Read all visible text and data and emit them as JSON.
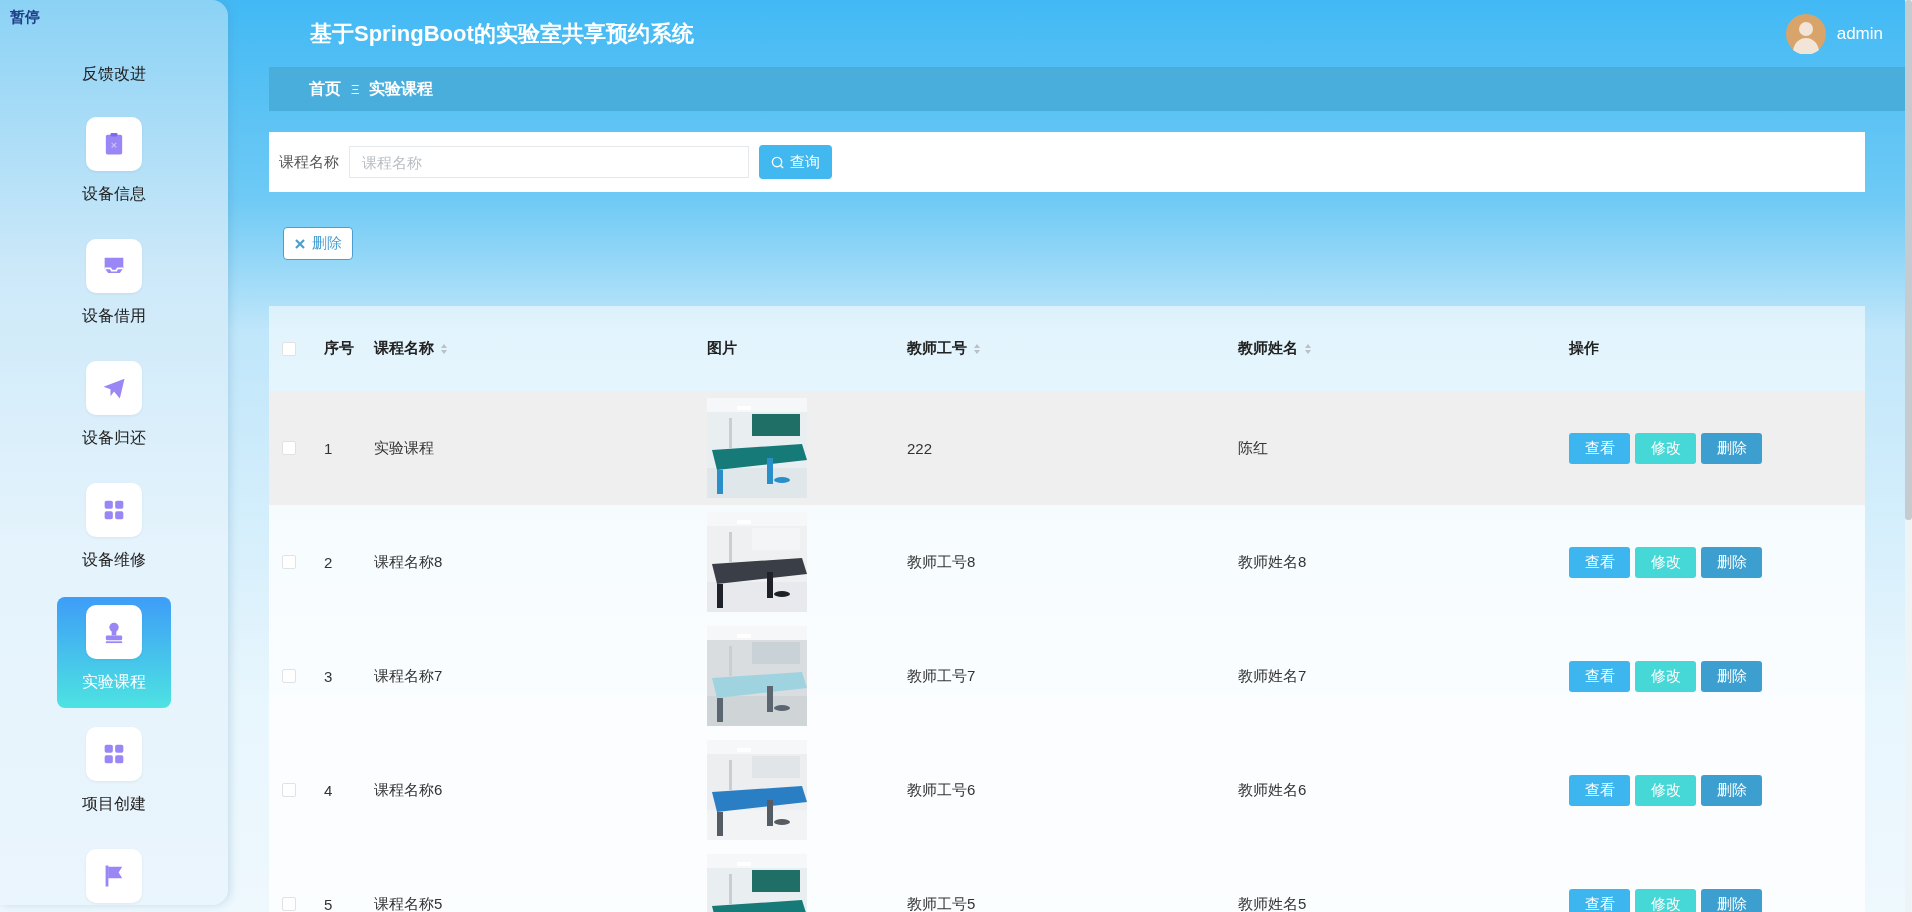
{
  "sidebar": {
    "pause_label": "暂停",
    "items": [
      {
        "label": "反馈改进",
        "selected": false
      },
      {
        "label": "设备信息",
        "selected": false
      },
      {
        "label": "设备借用",
        "selected": false
      },
      {
        "label": "设备归还",
        "selected": false
      },
      {
        "label": "设备维修",
        "selected": false
      },
      {
        "label": "实验课程",
        "selected": true
      },
      {
        "label": "项目创建",
        "selected": false
      },
      {
        "selected": false
      }
    ]
  },
  "header": {
    "title": "基于SpringBoot的实验室共享预约系统",
    "user": "admin"
  },
  "breadcrumb": {
    "items": [
      "首页",
      "实验课程"
    ],
    "separator": "Ξ"
  },
  "search": {
    "label": "课程名称",
    "placeholder": "课程名称",
    "button": "查询"
  },
  "toolbar": {
    "delete_button": "删除"
  },
  "table": {
    "select_all": {
      "checked": false
    },
    "columns": [
      {
        "label": "序号",
        "sortable": false
      },
      {
        "label": "课程名称",
        "sortable": true
      },
      {
        "label": "图片",
        "sortable": false
      },
      {
        "label": "教师工号",
        "sortable": true
      },
      {
        "label": "教师姓名",
        "sortable": true
      },
      {
        "label": "操作",
        "sortable": false
      }
    ],
    "rows": [
      {
        "checked": false,
        "highlighted": true,
        "index": "1",
        "name": "实验课程",
        "teacher_id": "222",
        "teacher_name": "陈红",
        "actions": [
          {
            "kind": "view",
            "label": "查看"
          },
          {
            "kind": "edit",
            "label": "修改"
          },
          {
            "kind": "delete",
            "label": "删除"
          }
        ]
      },
      {
        "checked": false,
        "highlighted": false,
        "index": "2",
        "name": "课程名称8",
        "teacher_id": "教师工号8",
        "teacher_name": "教师姓名8",
        "actions": [
          {
            "kind": "view",
            "label": "查看"
          },
          {
            "kind": "edit",
            "label": "修改"
          },
          {
            "kind": "delete",
            "label": "删除"
          }
        ]
      },
      {
        "checked": false,
        "highlighted": false,
        "index": "3",
        "name": "课程名称7",
        "teacher_id": "教师工号7",
        "teacher_name": "教师姓名7",
        "actions": [
          {
            "kind": "view",
            "label": "查看"
          },
          {
            "kind": "edit",
            "label": "修改"
          },
          {
            "kind": "delete",
            "label": "删除"
          }
        ]
      },
      {
        "checked": false,
        "highlighted": false,
        "index": "4",
        "name": "课程名称6",
        "teacher_id": "教师工号6",
        "teacher_name": "教师姓名6",
        "actions": [
          {
            "kind": "view",
            "label": "查看"
          },
          {
            "kind": "edit",
            "label": "修改"
          },
          {
            "kind": "delete",
            "label": "删除"
          }
        ]
      },
      {
        "checked": false,
        "highlighted": false,
        "index": "5",
        "name": "课程名称5",
        "teacher_id": "教师工号5",
        "teacher_name": "教师姓名5",
        "actions": [
          {
            "kind": "view",
            "label": "查看"
          },
          {
            "kind": "edit",
            "label": "修改"
          },
          {
            "kind": "delete",
            "label": "删除"
          }
        ]
      }
    ]
  }
}
